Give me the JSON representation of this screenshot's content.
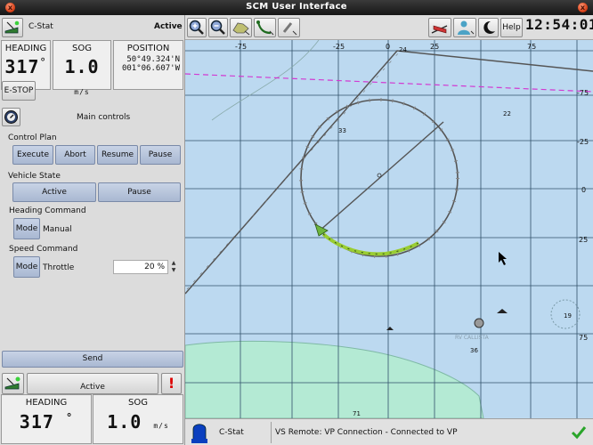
{
  "window": {
    "title": "SCM User Interface",
    "close_glyph": "x"
  },
  "header": {
    "vehicle": "C-Stat",
    "state": "Active"
  },
  "readouts": {
    "heading_label": "HEADING",
    "heading_value": "317",
    "heading_unit": "°",
    "sog_label": "SOG",
    "sog_value": "1.0",
    "sog_unit": "m/s",
    "position_label": "POSITION",
    "lat": "50°49.324'N",
    "lon": "001°06.607'W"
  },
  "estop": "E-STOP",
  "main_controls": "Main controls",
  "control_plan": {
    "title": "Control Plan",
    "buttons": [
      "Execute",
      "Abort",
      "Resume",
      "Pause"
    ]
  },
  "vehicle_state": {
    "title": "Vehicle State",
    "buttons": [
      "Active",
      "Pause"
    ]
  },
  "heading_command": {
    "title": "Heading Command",
    "mode_label": "Mode",
    "mode_value": "Manual"
  },
  "speed_command": {
    "title": "Speed Command",
    "mode_label": "Mode",
    "mode_value": "Throttle",
    "throttle": "20 %"
  },
  "send": "Send",
  "bottom": {
    "state": "Active",
    "alert_glyph": "!",
    "heading_label": "HEADING",
    "heading_value": "317",
    "heading_unit": "°",
    "sog_label": "SOG",
    "sog_value": "1.0",
    "sog_unit": "m/s"
  },
  "toolbar": {
    "help": "Help",
    "clock": "12:54:01"
  },
  "map": {
    "top_ticks": [
      "-75",
      "-25",
      "0",
      "25",
      "75"
    ],
    "right_ticks": [
      "-75",
      "-25",
      "0",
      "25",
      "75"
    ],
    "soundings": [
      "24",
      "33",
      "22",
      "19",
      "36",
      "71"
    ],
    "vessel_label": "RV CALLISTA"
  },
  "statusbar": {
    "vehicle": "C-Stat",
    "message": "VS Remote: VP Connection - Connected to VP"
  },
  "colors": {
    "sea": "#bcd9f0",
    "land": "#b4ead4",
    "accent": "#a9b8d2",
    "track": "#9acd32"
  }
}
